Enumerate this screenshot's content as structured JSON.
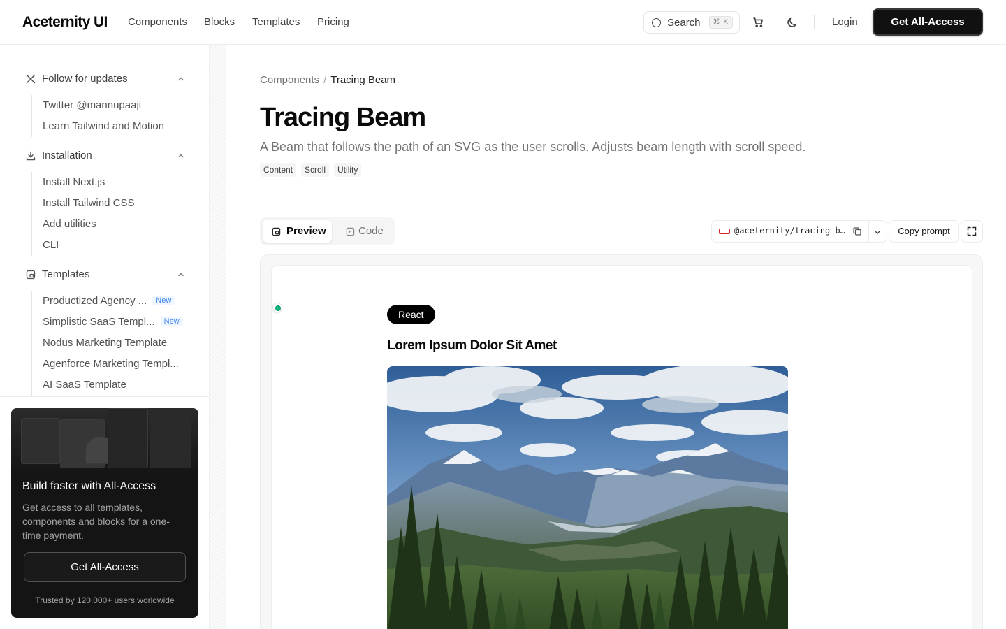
{
  "header": {
    "logo": "Aceternity UI",
    "nav": [
      "Components",
      "Blocks",
      "Templates",
      "Pricing"
    ],
    "search_label": "Search",
    "search_shortcut": "⌘ K",
    "login": "Login",
    "cta": "Get All-Access"
  },
  "sidebar": {
    "sections": [
      {
        "title": "Follow for updates",
        "icon": "x-logo-icon",
        "items": [
          {
            "label": "Twitter @mannupaaji"
          },
          {
            "label": "Learn Tailwind and Motion"
          }
        ]
      },
      {
        "title": "Installation",
        "icon": "download-icon",
        "items": [
          {
            "label": "Install Next.js"
          },
          {
            "label": "Install Tailwind CSS"
          },
          {
            "label": "Add utilities"
          },
          {
            "label": "CLI"
          }
        ]
      },
      {
        "title": "Templates",
        "icon": "template-icon",
        "items": [
          {
            "label": "Productized Agency ...",
            "badge": "New"
          },
          {
            "label": "Simplistic SaaS Templ...",
            "badge": "New"
          },
          {
            "label": "Nodus Marketing Template"
          },
          {
            "label": "Agenforce Marketing Templ..."
          },
          {
            "label": "AI SaaS Template"
          }
        ]
      }
    ],
    "promo": {
      "title": "Build faster with All-Access",
      "text": "Get access to all templates, components and blocks for a one-time payment.",
      "button": "Get All-Access",
      "footer": "Trusted by 120,000+ users worldwide"
    }
  },
  "main": {
    "breadcrumb": {
      "parent": "Components",
      "separator": "/",
      "current": "Tracing Beam"
    },
    "title": "Tracing Beam",
    "description": "A Beam that follows the path of an SVG as the user scrolls. Adjusts beam length with scroll speed.",
    "tags": [
      "Content",
      "Scroll",
      "Utility"
    ],
    "tabs": {
      "preview": "Preview",
      "code": "Code",
      "active": "Preview"
    },
    "cli_command": "@aceternity/tracing-b…",
    "copy_prompt": "Copy prompt",
    "preview": {
      "badge": "React",
      "heading": "Lorem Ipsum Dolor Sit Amet",
      "image_alt": "mountain landscape with pine trees"
    }
  },
  "colors": {
    "accent_green": "#10b981",
    "cli_red": "#dc2626",
    "dark": "#111111"
  }
}
